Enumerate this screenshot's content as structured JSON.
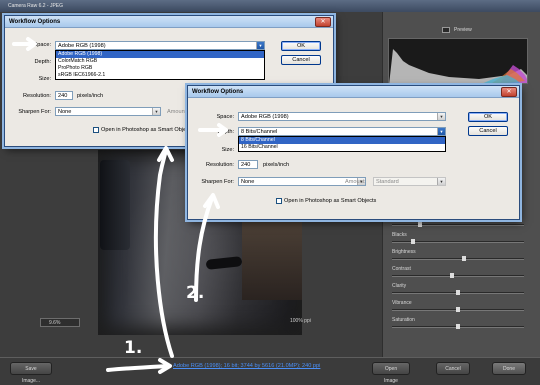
{
  "app": {
    "window_title": "Camera Raw 6.2 - JPEG",
    "preview_label": "Preview",
    "zoom_value": "9.6%",
    "zoom_percent_readout": "100% ppi",
    "panel_sliders": [
      {
        "label": "Fill Light",
        "value": 0.2
      },
      {
        "label": "Blacks",
        "value": 0.15
      },
      {
        "label": "Brightness",
        "value": 0.55
      },
      {
        "label": "Contrast",
        "value": 0.45
      },
      {
        "label": "Clarity",
        "value": 0.5
      },
      {
        "label": "Vibrance",
        "value": 0.5
      },
      {
        "label": "Saturation",
        "value": 0.5
      }
    ],
    "save_image_label": "Save Image...",
    "open_image_label": "Open Image",
    "cancel_label": "Cancel",
    "done_label": "Done",
    "workflow_link": "Adobe RGB (1998); 16 bit; 3744 by 5616 (21.0MP); 240 ppi"
  },
  "dialog_back": {
    "title": "Workflow Options",
    "space_label": "Space:",
    "space_value": "Adobe RGB (1998)",
    "space_options": [
      "Adobe RGB (1998)",
      "ColorMatch RGB",
      "ProPhoto RGB",
      "sRGB IEC61966-2.1"
    ],
    "space_selected_index": 0,
    "depth_label": "Depth:",
    "size_label": "Size:",
    "resolution_label": "Resolution:",
    "resolution_value": "240",
    "resolution_unit": "pixels/inch",
    "sharpen_label": "Sharpen For:",
    "sharpen_value": "None",
    "amount_label": "Amount:",
    "smart_objects_label": "Open in Photoshop as Smart Objects",
    "ok_label": "OK",
    "cancel_label": "Cancel"
  },
  "dialog_front": {
    "title": "Workflow Options",
    "space_label": "Space:",
    "space_value": "Adobe RGB (1998)",
    "depth_label": "Depth:",
    "depth_value": "8 Bits/Channel",
    "depth_options": [
      "8 Bits/Channel",
      "16 Bits/Channel"
    ],
    "depth_selected_index": 0,
    "size_label": "Size:",
    "resolution_label": "Resolution:",
    "resolution_value": "240",
    "resolution_unit": "pixels/inch",
    "sharpen_label": "Sharpen For:",
    "sharpen_value": "None",
    "amount_label": "Amount:",
    "amount_value": "Standard",
    "smart_objects_label": "Open in Photoshop as Smart Objects",
    "ok_label": "OK",
    "cancel_label": "Cancel"
  },
  "annotations": {
    "step1": "1.",
    "step2": "2."
  },
  "colors": {
    "dialog_bg": "#ece9e4",
    "selection_blue": "#3165c5",
    "link_blue": "#4b8ff6",
    "annotation": "#ffffff"
  }
}
